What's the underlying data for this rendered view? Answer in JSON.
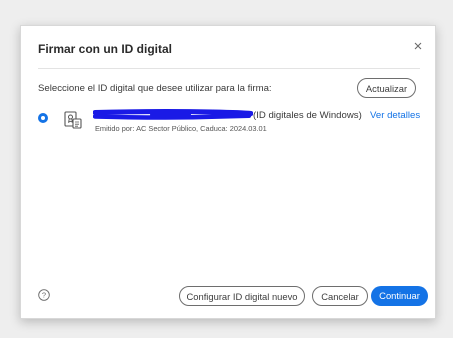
{
  "dialog": {
    "title": "Firmar con un ID digital",
    "close_icon": "close-icon",
    "prompt": "Seleccione el ID digital que desee utilizar para la firma:",
    "refresh_label": "Actualizar"
  },
  "identity": {
    "selected": true,
    "icon": "certificate-icon",
    "type_label": "(ID digitales de Windows)",
    "details_link": "Ver detalles",
    "issuer_line": "Emitido por: AC Sector Público, Caduca: 2024.03.01"
  },
  "footer": {
    "help_icon": "help-icon",
    "configure_label": "Configurar ID digital nuevo",
    "cancel_label": "Cancelar",
    "continue_label": "Continuar"
  },
  "colors": {
    "accent": "#1473e6",
    "redaction": "#1a1ae6"
  }
}
